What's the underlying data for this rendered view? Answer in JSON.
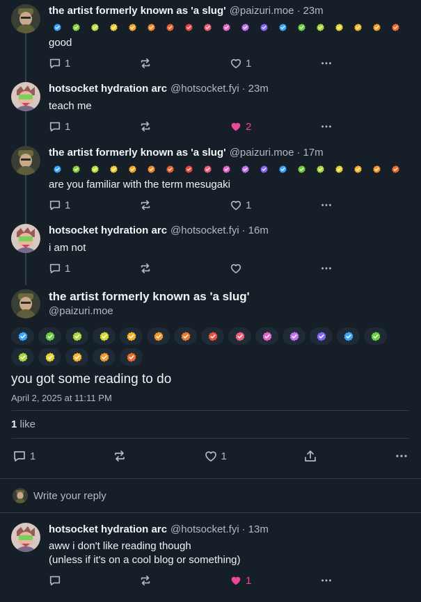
{
  "badge_colors": [
    "#3ea6ff",
    "#8bd13b",
    "#c2e03b",
    "#f3cb32",
    "#f5a623",
    "#f28b2b",
    "#ef5f2f",
    "#e8483b",
    "#f06078",
    "#e664c7",
    "#c173f0",
    "#8367f5",
    "#3ea6ff",
    "#6ccf3f",
    "#a8d83b",
    "#e6d430",
    "#f6b72e",
    "#f39a2c",
    "#ee6b2e"
  ],
  "chip_colors": [
    "#3ea6ff",
    "#6ccf3f",
    "#a8d83b",
    "#d8d834",
    "#f5b32a",
    "#f29630",
    "#ee7a2c",
    "#e8533a",
    "#f06078",
    "#e664c7",
    "#c173f0",
    "#8367f5",
    "#3ea6ff",
    "#6ccf3f",
    "#a8d83b",
    "#e6d430",
    "#f6b72e",
    "#f39a2c",
    "#ee6b2e"
  ],
  "posts": [
    {
      "name": "the artist formerly known as 'a slug'",
      "handle": "@paizuri.moe",
      "time": "23m",
      "text": "good",
      "replies": "1",
      "likes": "1",
      "liked": false,
      "badges": true,
      "avatar": "slug"
    },
    {
      "name": "hotsocket hydration arc",
      "handle": "@hotsocket.fyi",
      "time": "23m",
      "text": "teach me",
      "replies": "1",
      "likes": "2",
      "liked": true,
      "badges": false,
      "avatar": "hot"
    },
    {
      "name": "the artist formerly known as 'a slug'",
      "handle": "@paizuri.moe",
      "time": "17m",
      "text": "are you familiar with the term mesugaki",
      "replies": "1",
      "likes": "1",
      "liked": false,
      "badges": true,
      "avatar": "slug"
    },
    {
      "name": "hotsocket hydration arc",
      "handle": "@hotsocket.fyi",
      "time": "16m",
      "text": "i am not",
      "replies": "1",
      "likes": "",
      "liked": false,
      "badges": false,
      "avatar": "hot"
    }
  ],
  "focus": {
    "name": "the artist formerly known as 'a slug'",
    "handle": "@paizuri.moe",
    "text": "you got some reading to do",
    "date": "April 2, 2025 at 11:11 PM",
    "like_count": "1",
    "like_label": "like",
    "replies": "1",
    "likes": "1"
  },
  "reply_bar": {
    "placeholder": "Write your reply"
  },
  "reply": {
    "name": "hotsocket hydration arc",
    "handle": "@hotsocket.fyi",
    "time": "13m",
    "line1": "aww i don't like reading though",
    "line2": "(unless if it's on a cool blog or something)",
    "likes": "1"
  }
}
